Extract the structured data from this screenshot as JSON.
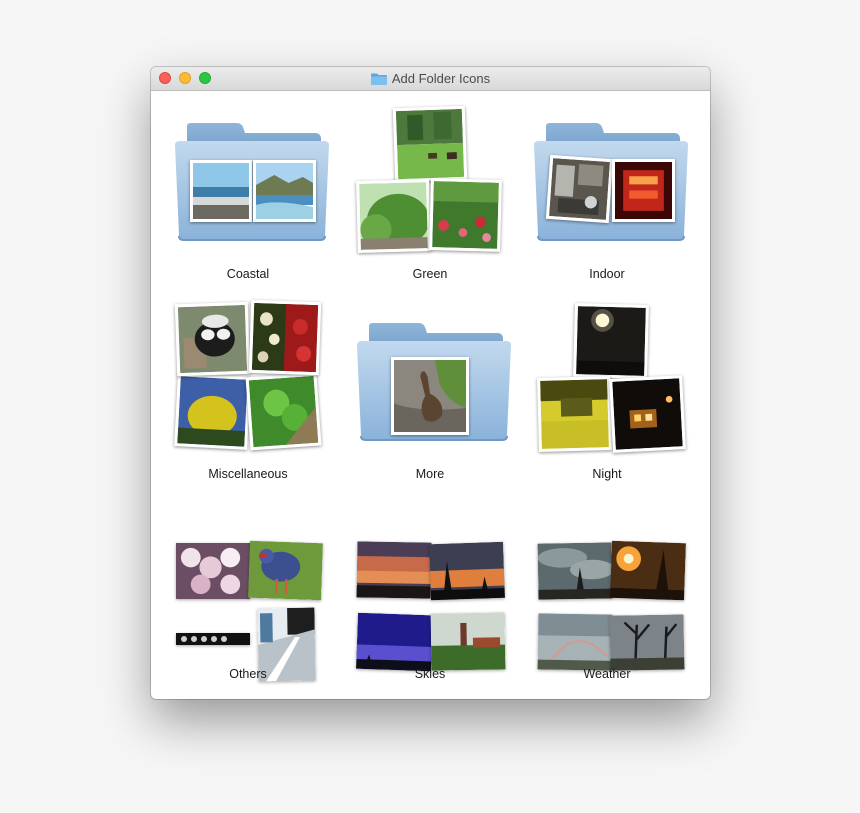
{
  "window": {
    "title": "Add Folder Icons",
    "title_icon": "folder-icon",
    "buttons": [
      "close-button",
      "minimize-button",
      "zoom-button"
    ]
  },
  "colors": {
    "folder": "#7ba7d1",
    "folder_light": "#a8c8e6",
    "window_bg": "#ffffff"
  },
  "folders": [
    {
      "label": "Coastal"
    },
    {
      "label": "Green"
    },
    {
      "label": "Indoor"
    },
    {
      "label": "Miscellaneous"
    },
    {
      "label": "More"
    },
    {
      "label": "Night"
    },
    {
      "label": "Others"
    },
    {
      "label": "Skies"
    },
    {
      "label": "Weather"
    }
  ]
}
